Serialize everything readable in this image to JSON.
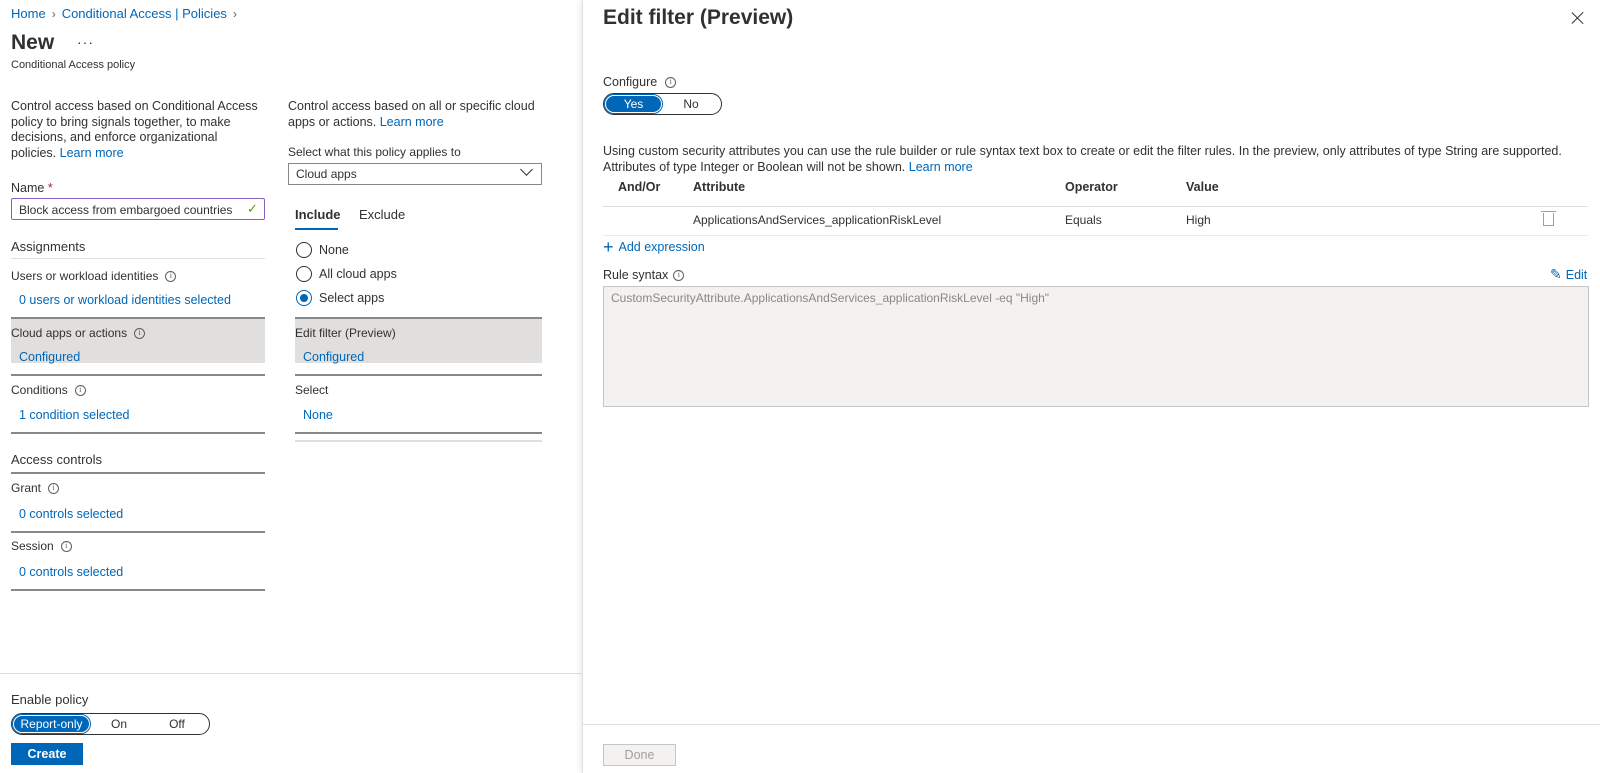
{
  "breadcrumb": {
    "home": "Home",
    "policies": "Conditional Access | Policies"
  },
  "page": {
    "title": "New",
    "more": "···",
    "subtitle": "Conditional Access policy"
  },
  "left": {
    "description": "Control access based on Conditional Access policy to bring signals together, to make decisions, and enforce organizational policies.",
    "learn_more": "Learn more",
    "name_label": "Name",
    "name_required": "*",
    "name_value": "Block access from embargoed countries",
    "assignments_head": "Assignments",
    "users_label": "Users or workload identities",
    "users_link": "0 users or workload identities selected",
    "cloud_label": "Cloud apps or actions",
    "cloud_link": "Configured",
    "conditions_label": "Conditions",
    "conditions_link": "1 condition selected",
    "access_head": "Access controls",
    "grant_label": "Grant",
    "grant_link": "0 controls selected",
    "session_label": "Session",
    "session_link": "0 controls selected"
  },
  "middle": {
    "description": "Control access based on all or specific cloud apps or actions.",
    "learn_more": "Learn more",
    "applies_label": "Select what this policy applies to",
    "applies_value": "Cloud apps",
    "tabs": {
      "include": "Include",
      "exclude": "Exclude"
    },
    "radios": {
      "none": "None",
      "all": "All cloud apps",
      "select": "Select apps"
    },
    "edit_filter_label": "Edit filter (Preview)",
    "edit_filter_link": "Configured",
    "select_label": "Select",
    "select_link": "None"
  },
  "enable": {
    "label": "Enable policy",
    "options": {
      "report": "Report-only",
      "on": "On",
      "off": "Off"
    },
    "selected": "Report-only",
    "create": "Create"
  },
  "filter_panel": {
    "title": "Edit filter (Preview)",
    "configure_label": "Configure",
    "configure_yes": "Yes",
    "configure_no": "No",
    "description": "Using custom security attributes you can use the rule builder or rule syntax text box to create or edit the filter rules. In the preview, only attributes of type String are supported. Attributes of type Integer or Boolean will not be shown.",
    "learn_more": "Learn more",
    "table": {
      "headers": {
        "andor": "And/Or",
        "attribute": "Attribute",
        "operator": "Operator",
        "value": "Value"
      },
      "row": {
        "andor": "",
        "attribute": "ApplicationsAndServices_applicationRiskLevel",
        "operator": "Equals",
        "value": "High"
      }
    },
    "add_expression": "Add expression",
    "rule_syntax_label": "Rule syntax",
    "edit": "Edit",
    "rule_syntax": "CustomSecurityAttribute.ApplicationsAndServices_applicationRiskLevel -eq \"High\"",
    "done": "Done"
  },
  "colors": {
    "accent": "#0067b8",
    "selected_bg": "#e1dfdd",
    "required": "#a4262c"
  }
}
